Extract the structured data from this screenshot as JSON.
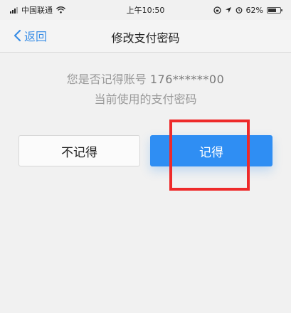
{
  "status": {
    "carrier": "中国联通",
    "time": "上午10:50",
    "battery": "62%"
  },
  "nav": {
    "back_label": "返回",
    "title": "修改支付密码"
  },
  "prompt": {
    "line1_prefix": "您是否记得账号",
    "account": "176******00",
    "line2": "当前使用的支付密码"
  },
  "buttons": {
    "no_label": "不记得",
    "yes_label": "记得"
  },
  "colors": {
    "accent": "#2f8ef3",
    "link": "#3a8ee6",
    "highlight": "#ee2a2a"
  }
}
